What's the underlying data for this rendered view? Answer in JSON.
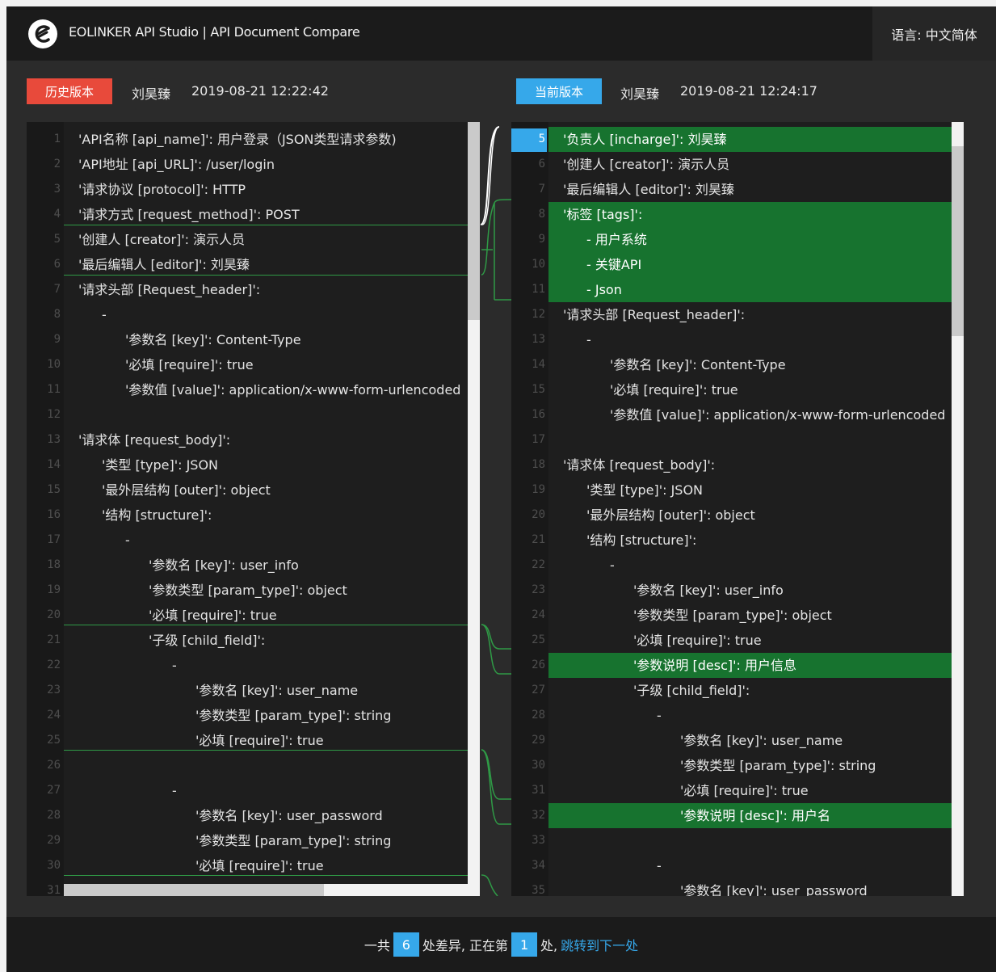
{
  "header": {
    "title": "EOLINKER API Studio | API Document Compare",
    "language": "语言: 中文简体",
    "logo_icon": "eolinker-logo-icon"
  },
  "history": {
    "badge": "历史版本",
    "author": "刘昊臻",
    "time": "2019-08-21 12:22:42"
  },
  "current": {
    "badge": "当前版本",
    "author": "刘昊臻",
    "time": "2019-08-21 12:24:17"
  },
  "left_lines": [
    {
      "n": "1",
      "t": "'API名称 [api_name]': 用户登录（JSON类型请求参数)",
      "i": 0
    },
    {
      "n": "2",
      "t": "'API地址 [api_URL]': /user/login",
      "i": 0
    },
    {
      "n": "3",
      "t": "'请求协议 [protocol]': HTTP",
      "i": 0
    },
    {
      "n": "4",
      "t": "'请求方式 [request_method]': POST",
      "i": 0
    },
    {
      "n": "5",
      "t": "'创建人 [creator]': 演示人员",
      "i": 0
    },
    {
      "n": "6",
      "t": "'最后编辑人 [editor]': 刘昊臻",
      "i": 0
    },
    {
      "n": "7",
      "t": "'请求头部 [Request_header]':",
      "i": 0
    },
    {
      "n": "8",
      "t": "-",
      "i": 1
    },
    {
      "n": "9",
      "t": "'参数名 [key]': Content-Type",
      "i": 2
    },
    {
      "n": "10",
      "t": "'必填 [require]': true",
      "i": 2
    },
    {
      "n": "11",
      "t": "'参数值 [value]': application/x-www-form-urlencoded",
      "i": 2
    },
    {
      "n": "12",
      "t": "",
      "i": 0
    },
    {
      "n": "13",
      "t": "'请求体 [request_body]':",
      "i": 0
    },
    {
      "n": "14",
      "t": "'类型 [type]': JSON",
      "i": 1
    },
    {
      "n": "15",
      "t": "'最外层结构 [outer]': object",
      "i": 1
    },
    {
      "n": "16",
      "t": "'结构 [structure]':",
      "i": 1
    },
    {
      "n": "17",
      "t": "-",
      "i": 2
    },
    {
      "n": "18",
      "t": "'参数名 [key]': user_info",
      "i": 3
    },
    {
      "n": "19",
      "t": "'参数类型 [param_type]': object",
      "i": 3
    },
    {
      "n": "20",
      "t": "'必填 [require]': true",
      "i": 3
    },
    {
      "n": "21",
      "t": "'子级 [child_field]':",
      "i": 3
    },
    {
      "n": "22",
      "t": "-",
      "i": 4
    },
    {
      "n": "23",
      "t": "'参数名 [key]': user_name",
      "i": 5
    },
    {
      "n": "24",
      "t": "'参数类型 [param_type]': string",
      "i": 5
    },
    {
      "n": "25",
      "t": "'必填 [require]': true",
      "i": 5
    },
    {
      "n": "26",
      "t": "",
      "i": 0
    },
    {
      "n": "27",
      "t": "-",
      "i": 4
    },
    {
      "n": "28",
      "t": "'参数名 [key]': user_password",
      "i": 5
    },
    {
      "n": "29",
      "t": "'参数类型 [param_type]': string",
      "i": 5
    },
    {
      "n": "30",
      "t": "'必填 [require]': true",
      "i": 5
    },
    {
      "n": "31",
      "t": "",
      "i": 0
    }
  ],
  "right_lines": [
    {
      "n": "5",
      "t": "'负责人 [incharge]': 刘昊臻",
      "i": 0,
      "added": true,
      "active": true
    },
    {
      "n": "6",
      "t": "'创建人 [creator]': 演示人员",
      "i": 0
    },
    {
      "n": "7",
      "t": "'最后编辑人 [editor]': 刘昊臻",
      "i": 0
    },
    {
      "n": "8",
      "t": "'标签 [tags]':",
      "i": 0,
      "added": true
    },
    {
      "n": "9",
      "t": "- 用户系统",
      "i": 1,
      "added": true
    },
    {
      "n": "10",
      "t": "- 关键API",
      "i": 1,
      "added": true
    },
    {
      "n": "11",
      "t": "- Json",
      "i": 1,
      "added": true
    },
    {
      "n": "12",
      "t": "'请求头部 [Request_header]':",
      "i": 0
    },
    {
      "n": "13",
      "t": "-",
      "i": 1
    },
    {
      "n": "14",
      "t": "'参数名 [key]': Content-Type",
      "i": 2
    },
    {
      "n": "15",
      "t": "'必填 [require]': true",
      "i": 2
    },
    {
      "n": "16",
      "t": "'参数值 [value]': application/x-www-form-urlencoded",
      "i": 2
    },
    {
      "n": "17",
      "t": "",
      "i": 0
    },
    {
      "n": "18",
      "t": "'请求体 [request_body]':",
      "i": 0
    },
    {
      "n": "19",
      "t": "'类型 [type]': JSON",
      "i": 1
    },
    {
      "n": "20",
      "t": "'最外层结构 [outer]': object",
      "i": 1
    },
    {
      "n": "21",
      "t": "'结构 [structure]':",
      "i": 1
    },
    {
      "n": "22",
      "t": "-",
      "i": 2
    },
    {
      "n": "23",
      "t": "'参数名 [key]': user_info",
      "i": 3
    },
    {
      "n": "24",
      "t": "'参数类型 [param_type]': object",
      "i": 3
    },
    {
      "n": "25",
      "t": "'必填 [require]': true",
      "i": 3
    },
    {
      "n": "26",
      "t": "'参数说明 [desc]': 用户信息",
      "i": 3,
      "added": true
    },
    {
      "n": "27",
      "t": "'子级 [child_field]':",
      "i": 3
    },
    {
      "n": "28",
      "t": "-",
      "i": 4
    },
    {
      "n": "29",
      "t": "'参数名 [key]': user_name",
      "i": 5
    },
    {
      "n": "30",
      "t": "'参数类型 [param_type]': string",
      "i": 5
    },
    {
      "n": "31",
      "t": "'必填 [require]': true",
      "i": 5
    },
    {
      "n": "32",
      "t": "'参数说明 [desc]': 用户名",
      "i": 5,
      "added": true
    },
    {
      "n": "33",
      "t": "",
      "i": 0
    },
    {
      "n": "34",
      "t": "-",
      "i": 4
    },
    {
      "n": "35",
      "t": "'参数名 [key]': user_password",
      "i": 5
    }
  ],
  "footer": {
    "prefix": "一共",
    "total": "6",
    "middle": "处差异, 正在第",
    "current": "1",
    "suffix": "处,",
    "next_link": "跳转到下一处"
  }
}
